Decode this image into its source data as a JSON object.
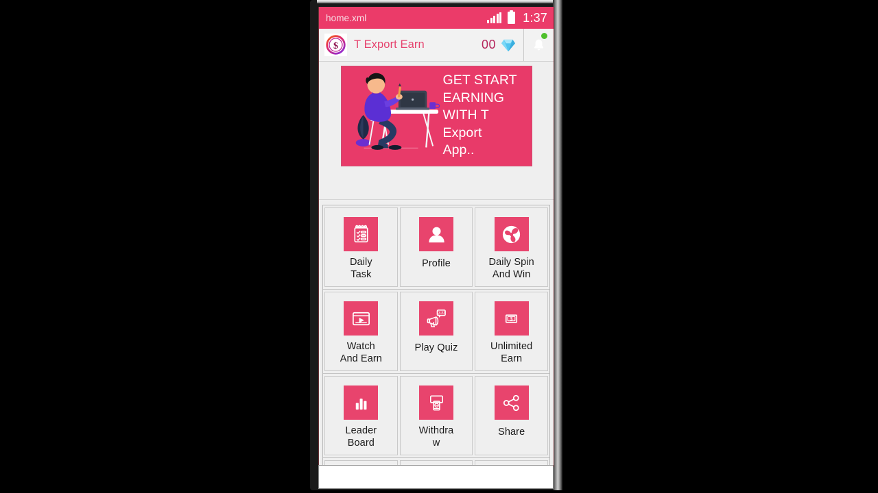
{
  "window": {
    "frame_color": "#1a1a1a",
    "screen_background": "#efefef"
  },
  "status_bar": {
    "file_name": "home.xml",
    "time": "1:37",
    "signal_icon": "signal-bars-icon",
    "battery_icon": "battery-icon",
    "background": "#eb3b69"
  },
  "app_bar": {
    "logo_icon": "dollar-circle-logo-icon",
    "title": "T Export Earn",
    "title_color": "#e6436e",
    "coin_count": "00",
    "gem_icon": "diamond-gem-icon",
    "bell_icon": "notification-bell-icon",
    "bell_badge_color": "#4ec02b"
  },
  "banner": {
    "background": "#e83a69",
    "illustration": "person-at-desk-with-laptop-illustration",
    "line1": "GET START",
    "line2": "EARNING",
    "line3": "WITH T",
    "line4": "Export",
    "line5": "App.."
  },
  "grid": {
    "icon_background": "#e8446d",
    "rows": [
      {
        "tiles": [
          {
            "label_line1": "Daily",
            "label_line2": "Task",
            "icon": "checklist-clipboard-icon"
          },
          {
            "label_line1": "Profile",
            "label_line2": "",
            "icon": "user-person-icon"
          },
          {
            "label_line1": "Daily Spin",
            "label_line2": "And Win",
            "icon": "spinner-wheel-icon"
          }
        ]
      },
      {
        "tiles": [
          {
            "label_line1": "Watch",
            "label_line2": "And Earn",
            "icon": "video-play-icon"
          },
          {
            "label_line1": "Play Quiz",
            "label_line2": "",
            "icon": "megaphone-quiz-icon"
          },
          {
            "label_line1": "Unlimited",
            "label_line2": "Earn",
            "icon": "money-bill-icon"
          }
        ]
      },
      {
        "tiles": [
          {
            "label_line1": "Leader",
            "label_line2": "Board",
            "icon": "bar-chart-icon"
          },
          {
            "label_line1": "Withdra",
            "label_line2": "w",
            "icon": "atm-withdraw-icon"
          },
          {
            "label_line1": "Share",
            "label_line2": "",
            "icon": "share-nodes-icon"
          }
        ]
      }
    ]
  }
}
